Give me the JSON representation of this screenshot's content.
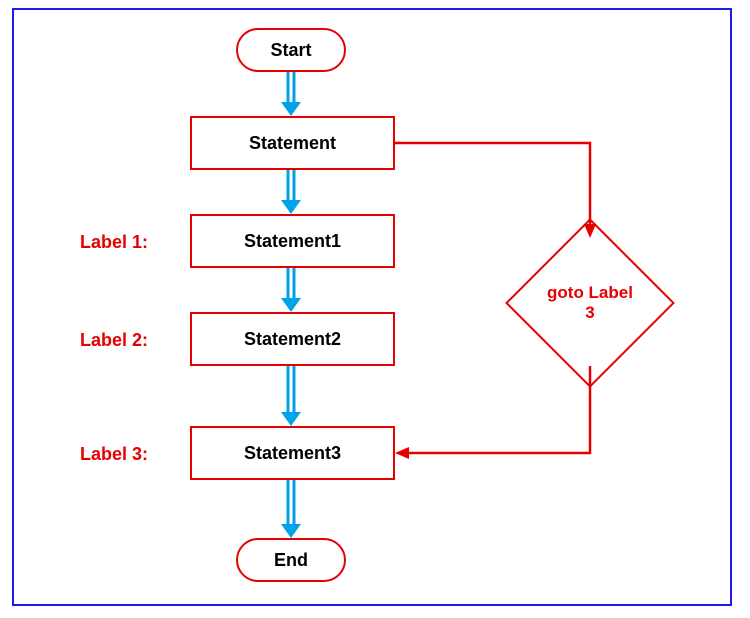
{
  "nodes": {
    "start": "Start",
    "stmt": "Statement",
    "stmt1": "Statement1",
    "stmt2": "Statement2",
    "stmt3": "Statement3",
    "end": "End",
    "decision_l1": "goto Label",
    "decision_l2": "3"
  },
  "labels": {
    "l1": "Label 1:",
    "l2": "Label 2:",
    "l3": "Label 3:"
  }
}
